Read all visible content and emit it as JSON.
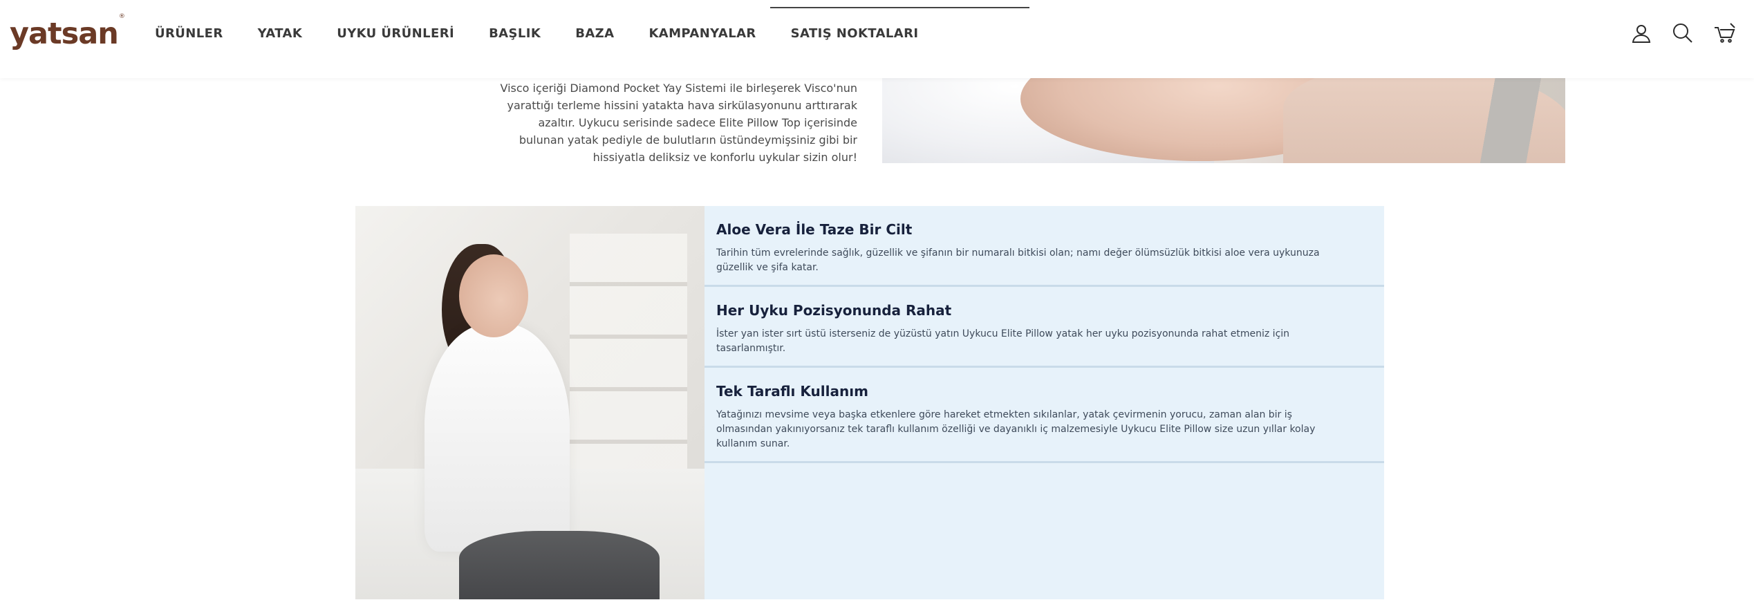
{
  "header": {
    "logo": "yatsan",
    "logo_mark": "®",
    "nav": [
      "ÜRÜNLER",
      "YATAK",
      "UYKU ÜRÜNLERİ",
      "BAŞLIK",
      "BAZA",
      "KAMPANYALAR",
      "SATIŞ NOKTALARI"
    ],
    "icons": [
      "user-icon",
      "search-icon",
      "cart-icon"
    ]
  },
  "intro": {
    "lines": [
      "Visco içeriği Diamond Pocket Yay Sistemi ile birleşerek Visco'nun",
      "yarattığı terleme hissini yatakta hava sirkülasyonunu arttırarak",
      "azaltır. Uykucu serisinde sadece Elite Pillow Top içerisinde",
      "bulunan yatak pediyle de bulutların üstündeymişsiniz gibi bir",
      "hissiyatla deliksiz ve konforlu uykular sizin olur!"
    ]
  },
  "features": [
    {
      "title": "Aloe Vera İle Taze Bir Cilt",
      "lines": [
        "Tarihin tüm evrelerinde sağlık, güzellik ve şifanın bir numaralı bitkisi olan; namı değer ölümsüzlük bitkisi aloe vera uykunuza",
        "güzellik ve şifa katar."
      ]
    },
    {
      "title": "Her Uyku Pozisyonunda Rahat",
      "lines": [
        "İster yan ister sırt üstü isterseniz de yüzüstü yatın Uykucu Elite Pillow yatak her uyku pozisyonunda rahat etmeniz için",
        "tasarlanmıştır."
      ]
    },
    {
      "title": "Tek Taraflı Kullanım",
      "lines": [
        "Yatağınızı mevsime veya başka etkenlere göre hareket etmekten sıkılanlar, yatak çevirmenin yorucu, zaman alan bir iş",
        "olmasından yakınıyorsanız tek taraflı kullanım özelliği ve dayanıklı iç malzemesiyle Uykucu Elite Pillow size uzun yıllar kolay",
        "kullanım sunar."
      ]
    }
  ],
  "colors": {
    "brand": "#6b3a26",
    "feature_bg": "#e7f2fa",
    "feature_title": "#17213c"
  }
}
